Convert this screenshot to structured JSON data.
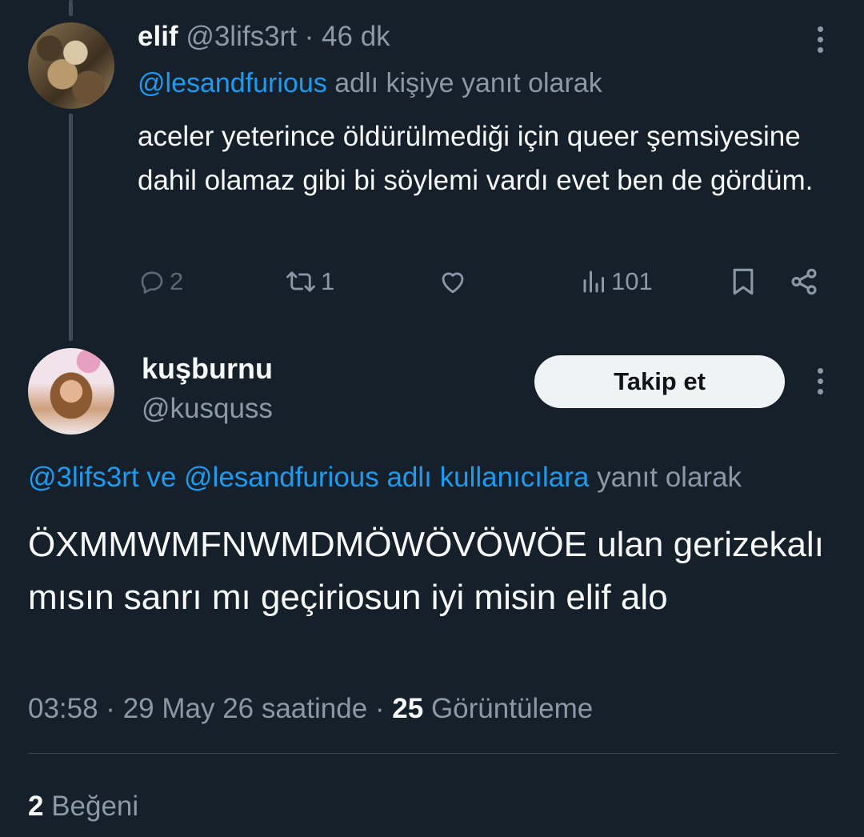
{
  "parent_tweet": {
    "display_name": "elif",
    "handle": "@3lifs3rt",
    "separator": " · ",
    "time_ago": "46 dk",
    "reply_to_handle": "@lesandfurious",
    "reply_to_suffix": " adlı kişiye yanıt olarak",
    "text": "aceler yeterince öldürülmediği için queer şemsiyesine dahil olamaz gibi bi söylemi vardı evet ben de gördüm.",
    "stats": {
      "replies": "2",
      "retweets": "1",
      "views": "101"
    }
  },
  "main_tweet": {
    "display_name": "kuşburnu",
    "handle": "@kusquss",
    "follow_label": "Takip et",
    "reply_to_links": "@3lifs3rt ve @lesandfurious adlı kullanıcılara",
    "reply_to_suffix": " yanıt olarak",
    "text": "ÖXMMWMFNWMDMÖWÖVÖWÖE ulan gerizekalı mısın sanrı mı geçiriosun iyi misin elif alo",
    "timestamp": "03:58 · 29 May 26 saatinde · ",
    "view_count": "25",
    "view_label": " Görüntüleme",
    "like_count": "2",
    "like_label": " Beğeni"
  },
  "icons": [
    "more-vertical-icon",
    "reply-icon",
    "retweet-icon",
    "like-icon",
    "views-icon",
    "bookmark-icon",
    "share-icon"
  ]
}
